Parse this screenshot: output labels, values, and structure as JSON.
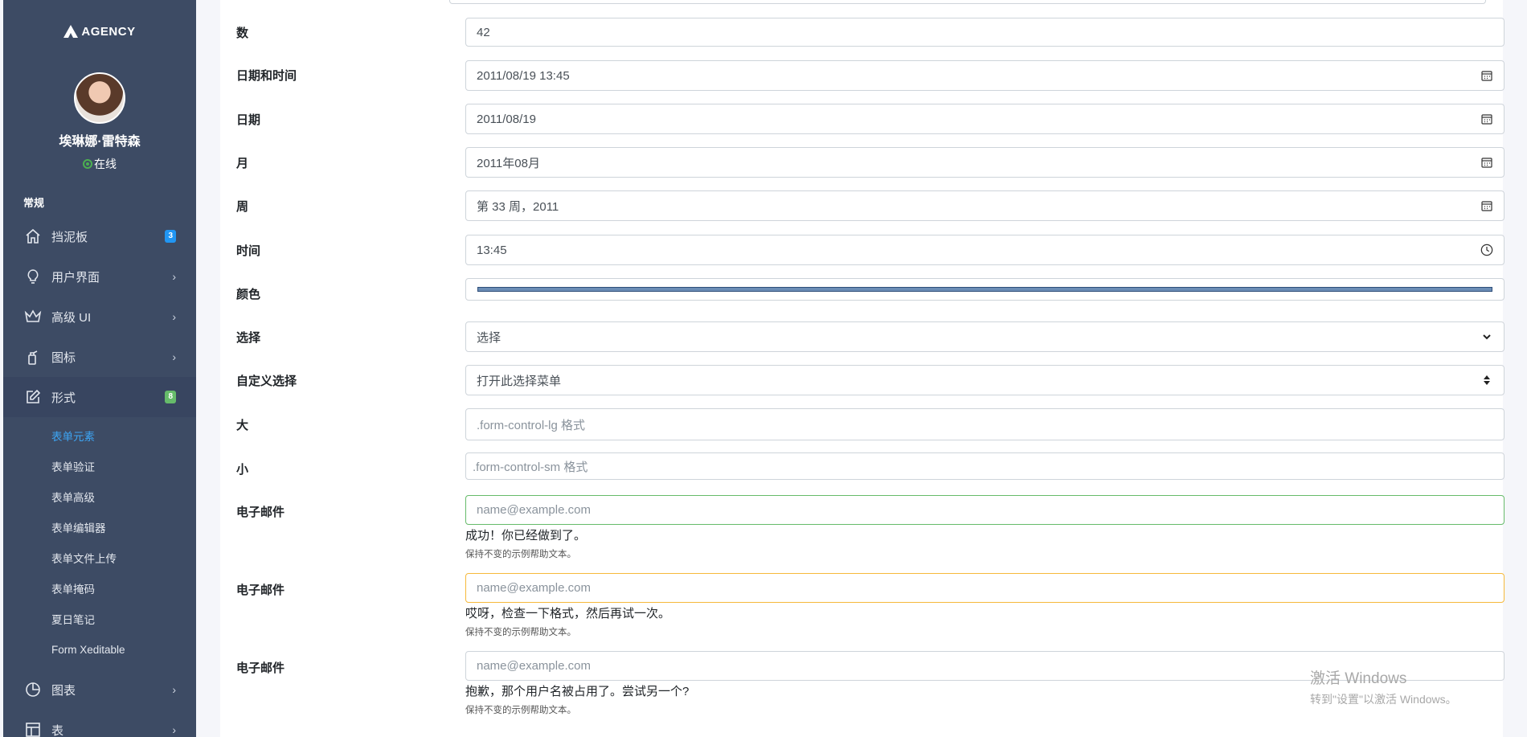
{
  "brand": {
    "name": "AGENCY"
  },
  "profile": {
    "name": "埃琳娜·雷特森",
    "status": "在线"
  },
  "sidebar": {
    "section": "常规",
    "items": [
      {
        "label": "挡泥板",
        "icon": "home-icon",
        "badge": "3"
      },
      {
        "label": "用户界面",
        "icon": "lightbulb-icon"
      },
      {
        "label": "高级 UI",
        "icon": "crown-icon"
      },
      {
        "label": "图标",
        "icon": "spray-icon"
      },
      {
        "label": "形式",
        "icon": "edit-icon",
        "badge": "8"
      }
    ],
    "sub_items": [
      "表单元素",
      "表单验证",
      "表单高级",
      "表单编辑器",
      "表单文件上传",
      "表单掩码",
      "夏日笔记",
      "Form Xeditable"
    ],
    "items_after": [
      {
        "label": "图表",
        "icon": "pie-chart-icon"
      },
      {
        "label": "表",
        "icon": "layout-icon"
      }
    ]
  },
  "form": {
    "number": {
      "label": "数",
      "value": "42"
    },
    "datetime": {
      "label": "日期和时间",
      "value": "2011/08/19 13:45"
    },
    "date": {
      "label": "日期",
      "value": "2011/08/19"
    },
    "month": {
      "label": "月",
      "value": "2011年08月"
    },
    "week": {
      "label": "周",
      "value": "第 33 周，2011"
    },
    "time": {
      "label": "时间",
      "value": "13:45"
    },
    "color": {
      "label": "颜色",
      "value": "#6b8cb5"
    },
    "select": {
      "label": "选择",
      "value": "选择"
    },
    "custom_select": {
      "label": "自定义选择",
      "value": "打开此选择菜单"
    },
    "large": {
      "label": "大",
      "placeholder": ".form-control-lg 格式"
    },
    "small": {
      "label": "小",
      "placeholder": ".form-control-sm 格式"
    },
    "email_success": {
      "label": "电子邮件",
      "placeholder": "name@example.com",
      "feedback": "成功！你已经做到了。",
      "help": "保持不变的示例帮助文本。"
    },
    "email_warning": {
      "label": "电子邮件",
      "placeholder": "name@example.com",
      "feedback": "哎呀，检查一下格式，然后再试一次。",
      "help": "保持不变的示例帮助文本。"
    },
    "email_error": {
      "label": "电子邮件",
      "placeholder": "name@example.com",
      "feedback": "抱歉，那个用户名被占用了。尝试另一个?",
      "help": "保持不变的示例帮助文本。"
    }
  },
  "watermark": {
    "title": "激活 Windows",
    "subtitle": "转到\"设置\"以激活 Windows。"
  },
  "colors": {
    "sidebar_bg": "#3d4b64",
    "accent": "#3da5f4",
    "success": "#66bb6a",
    "warning": "#f6b93b"
  }
}
